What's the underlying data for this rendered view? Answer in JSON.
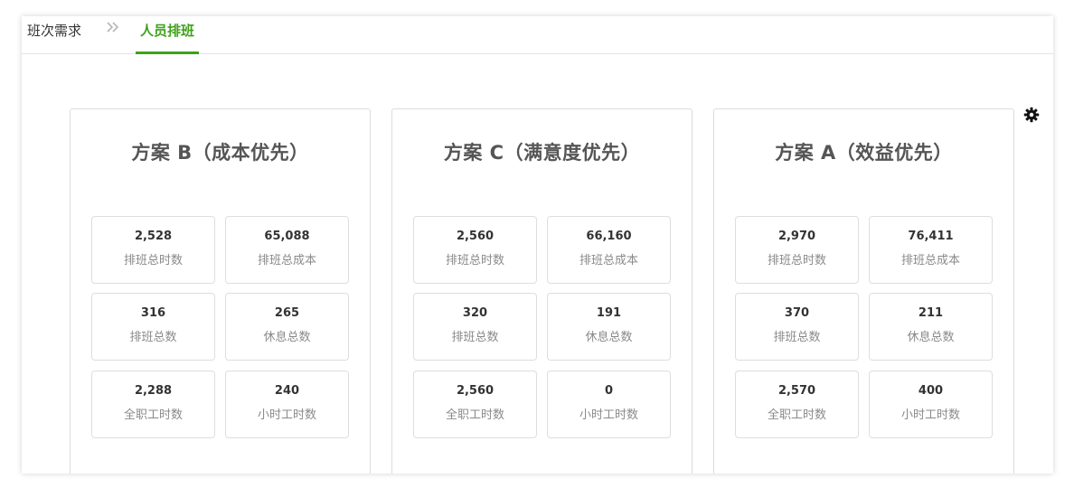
{
  "breadcrumb": {
    "step1": "班次需求",
    "step2": "人员排班"
  },
  "colors": {
    "accent": "#3fa21a",
    "title_text": "#555555",
    "label_text": "#8a8a8a"
  },
  "icons": {
    "settings": "gear-icon",
    "separator": "double-chevron-right-icon"
  },
  "plans": [
    {
      "title": "方案 B（成本优先）",
      "stats": [
        {
          "value": "2,528",
          "label": "排班总时数"
        },
        {
          "value": "65,088",
          "label": "排班总成本"
        },
        {
          "value": "316",
          "label": "排班总数"
        },
        {
          "value": "265",
          "label": "休息总数"
        },
        {
          "value": "2,288",
          "label": "全职工时数"
        },
        {
          "value": "240",
          "label": "小时工时数"
        }
      ]
    },
    {
      "title": "方案 C（满意度优先）",
      "stats": [
        {
          "value": "2,560",
          "label": "排班总时数"
        },
        {
          "value": "66,160",
          "label": "排班总成本"
        },
        {
          "value": "320",
          "label": "排班总数"
        },
        {
          "value": "191",
          "label": "休息总数"
        },
        {
          "value": "2,560",
          "label": "全职工时数"
        },
        {
          "value": "0",
          "label": "小时工时数"
        }
      ]
    },
    {
      "title": "方案 A（效益优先）",
      "stats": [
        {
          "value": "2,970",
          "label": "排班总时数"
        },
        {
          "value": "76,411",
          "label": "排班总成本"
        },
        {
          "value": "370",
          "label": "排班总数"
        },
        {
          "value": "211",
          "label": "休息总数"
        },
        {
          "value": "2,570",
          "label": "全职工时数"
        },
        {
          "value": "400",
          "label": "小时工时数"
        }
      ]
    }
  ]
}
